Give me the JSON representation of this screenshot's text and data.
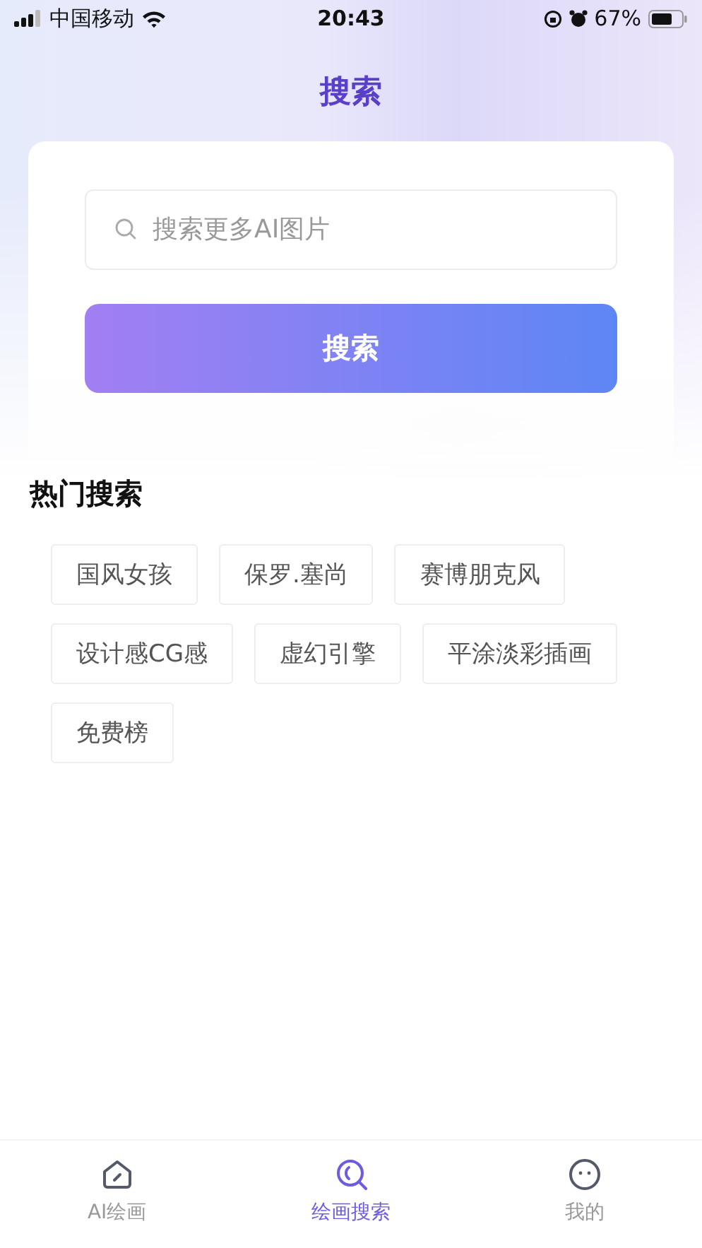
{
  "status_bar": {
    "carrier": "中国移动",
    "time": "20:43",
    "battery": "67%"
  },
  "header": {
    "title": "搜索"
  },
  "search": {
    "placeholder": "搜索更多AI图片",
    "button": "搜索"
  },
  "hot": {
    "title": "热门搜索",
    "tags": [
      "国风女孩",
      "保罗.塞尚",
      "赛博朋克风",
      "设计感CG感",
      "虚幻引擎",
      "平涂淡彩插画",
      "免费榜"
    ]
  },
  "tab_bar": [
    {
      "kind": "draw",
      "label": "AI绘画",
      "selected": false
    },
    {
      "kind": "search",
      "label": "绘画搜索",
      "selected": true
    },
    {
      "kind": "profile",
      "label": "我的",
      "selected": false
    }
  ]
}
